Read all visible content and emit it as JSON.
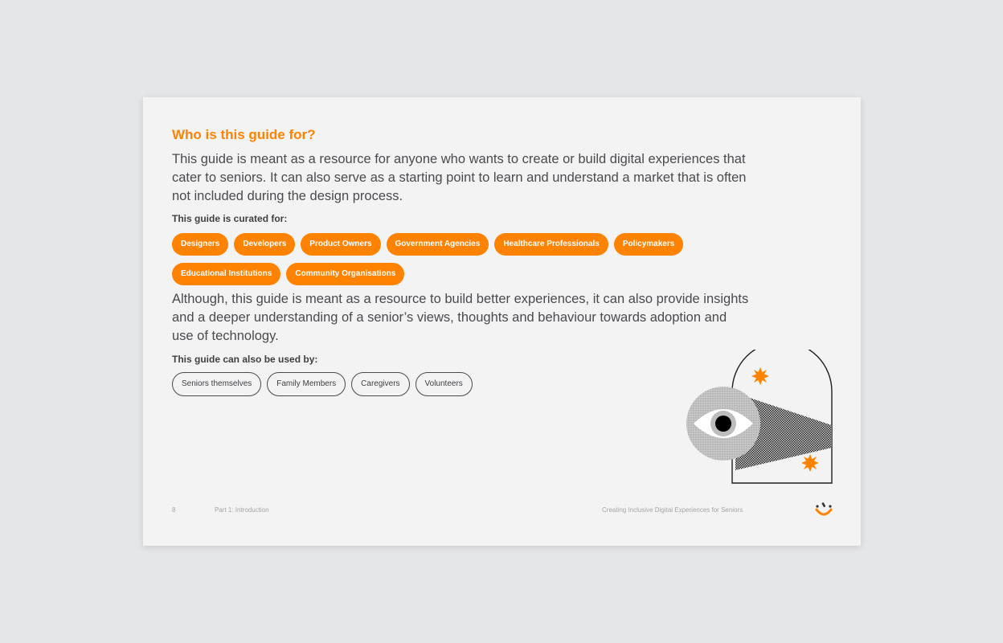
{
  "heading": "Who is this guide for?",
  "intro_paragraph": "This guide is meant as a resource for anyone who wants to create or build digital experiences that cater to seniors. It can also serve as a starting point to learn and understand a market that is often not included during the design process.",
  "curated_label": "This guide is curated for:",
  "curated_for": [
    "Designers",
    "Developers",
    "Product Owners",
    "Government Agencies",
    "Healthcare Professionals",
    "Policymakers",
    "Educational Institutions",
    "Community Organisations"
  ],
  "secondary_paragraph": "Although, this guide is meant as a resource to build better experiences, it can also provide insights and a deeper understanding of a senior’s views, thoughts and behaviour towards adoption and use of technology.",
  "also_used_label": "This guide can also be used by:",
  "also_used_by": [
    "Seniors themselves",
    "Family Members",
    "Caregivers",
    "Volunteers"
  ],
  "illustration": {
    "icon": "eye-looking-through-doorway-illustration",
    "accent_icons": [
      "starburst-icon",
      "starburst-icon"
    ]
  },
  "footer": {
    "page_number": "8",
    "section": "Part 1: Introduction",
    "document_title": "Creating Inclusive Digital Experiences for Seniors",
    "logo_icon": "smiley-logo-icon"
  },
  "colors": {
    "accent": "#ff8200",
    "text": "#4a4a4f",
    "page_background": "#f3f3f3",
    "canvas_background": "#e5e6e8"
  }
}
